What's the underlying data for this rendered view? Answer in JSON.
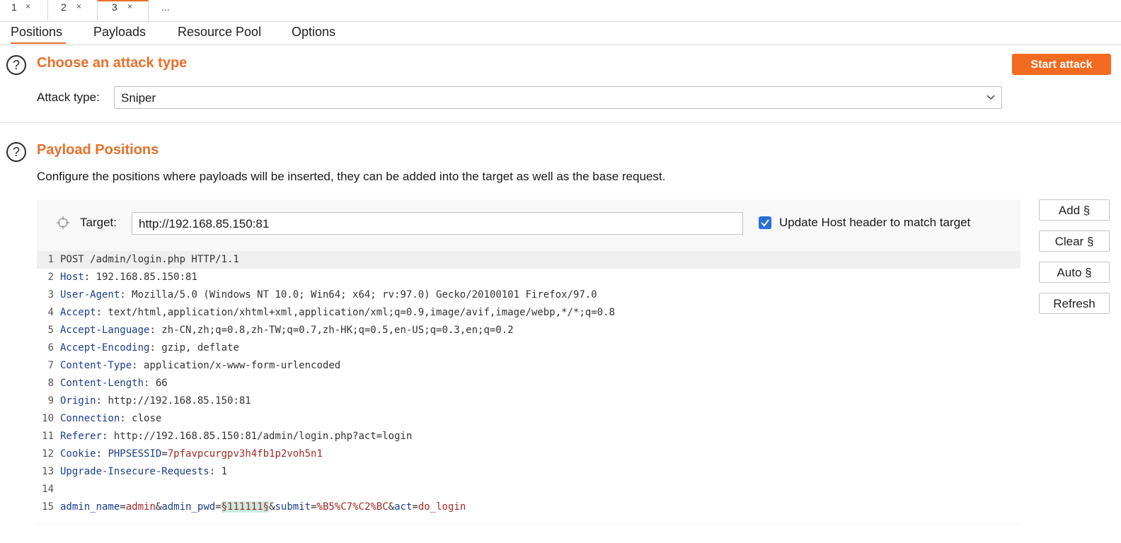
{
  "top_tabs": [
    {
      "label": "1",
      "close": "×"
    },
    {
      "label": "2",
      "close": "×"
    },
    {
      "label": "3",
      "close": "×"
    },
    {
      "label": "..."
    }
  ],
  "sub_tabs": [
    "Positions",
    "Payloads",
    "Resource Pool",
    "Options"
  ],
  "attack": {
    "title": "Choose an attack type",
    "start_label": "Start attack",
    "type_label": "Attack type:",
    "type_value": "Sniper",
    "help": "?"
  },
  "positions": {
    "title": "Payload Positions",
    "help": "?",
    "description": "Configure the positions where payloads will be inserted, they can be added into the target as well as the base request.",
    "target_label": "Target:",
    "target_value": "http://192.168.85.150:81",
    "update_host_label": "Update Host header to match target",
    "update_host_checked": true
  },
  "side_buttons": [
    "Add §",
    "Clear §",
    "Auto §",
    "Refresh"
  ],
  "request_lines": [
    {
      "n": "1",
      "text": "POST /admin/login.php HTTP/1.1"
    },
    {
      "n": "2",
      "key": "Host",
      "val": " 192.168.85.150:81"
    },
    {
      "n": "3",
      "key": "User-Agent",
      "val": " Mozilla/5.0 (Windows NT 10.0; Win64; x64; rv:97.0) Gecko/20100101 Firefox/97.0"
    },
    {
      "n": "4",
      "key": "Accept",
      "val": " text/html,application/xhtml+xml,application/xml;q=0.9,image/avif,image/webp,*/*;q=0.8"
    },
    {
      "n": "5",
      "key": "Accept-Language",
      "val": " zh-CN,zh;q=0.8,zh-TW;q=0.7,zh-HK;q=0.5,en-US;q=0.3,en;q=0.2"
    },
    {
      "n": "6",
      "key": "Accept-Encoding",
      "val": " gzip, deflate"
    },
    {
      "n": "7",
      "key": "Content-Type",
      "val": " application/x-www-form-urlencoded"
    },
    {
      "n": "8",
      "key": "Content-Length",
      "val": " 66"
    },
    {
      "n": "9",
      "key": "Origin",
      "val": " http://192.168.85.150:81"
    },
    {
      "n": "10",
      "key": "Connection",
      "val": " close"
    },
    {
      "n": "11",
      "key": "Referer",
      "val": " http://192.168.85.150:81/admin/login.php?act=login"
    },
    {
      "n": "12",
      "key": "Cookie",
      "cookie_name": " PHPSESSID",
      "cookie_eq": "=",
      "cookie_val": "7pfavpcurgpv3h4fb1p2voh5n1"
    },
    {
      "n": "13",
      "key": "Upgrade-Insecure-Requests",
      "val": " 1"
    },
    {
      "n": "14"
    },
    {
      "n": "15",
      "body": [
        {
          "t": "admin_name",
          "c": "k"
        },
        {
          "t": "=",
          "c": "v"
        },
        {
          "t": "admin",
          "c": "red"
        },
        {
          "t": "&",
          "c": "v"
        },
        {
          "t": "admin_pwd",
          "c": "k"
        },
        {
          "t": "=",
          "c": "v"
        },
        {
          "t": "§111111§",
          "c": "pl"
        },
        {
          "t": "&",
          "c": "v"
        },
        {
          "t": "submit",
          "c": "k"
        },
        {
          "t": "=",
          "c": "v"
        },
        {
          "t": "%B5%C7%C2%BC",
          "c": "red"
        },
        {
          "t": "&",
          "c": "v"
        },
        {
          "t": "act",
          "c": "k"
        },
        {
          "t": "=",
          "c": "v"
        },
        {
          "t": "do_login",
          "c": "red"
        }
      ]
    }
  ]
}
